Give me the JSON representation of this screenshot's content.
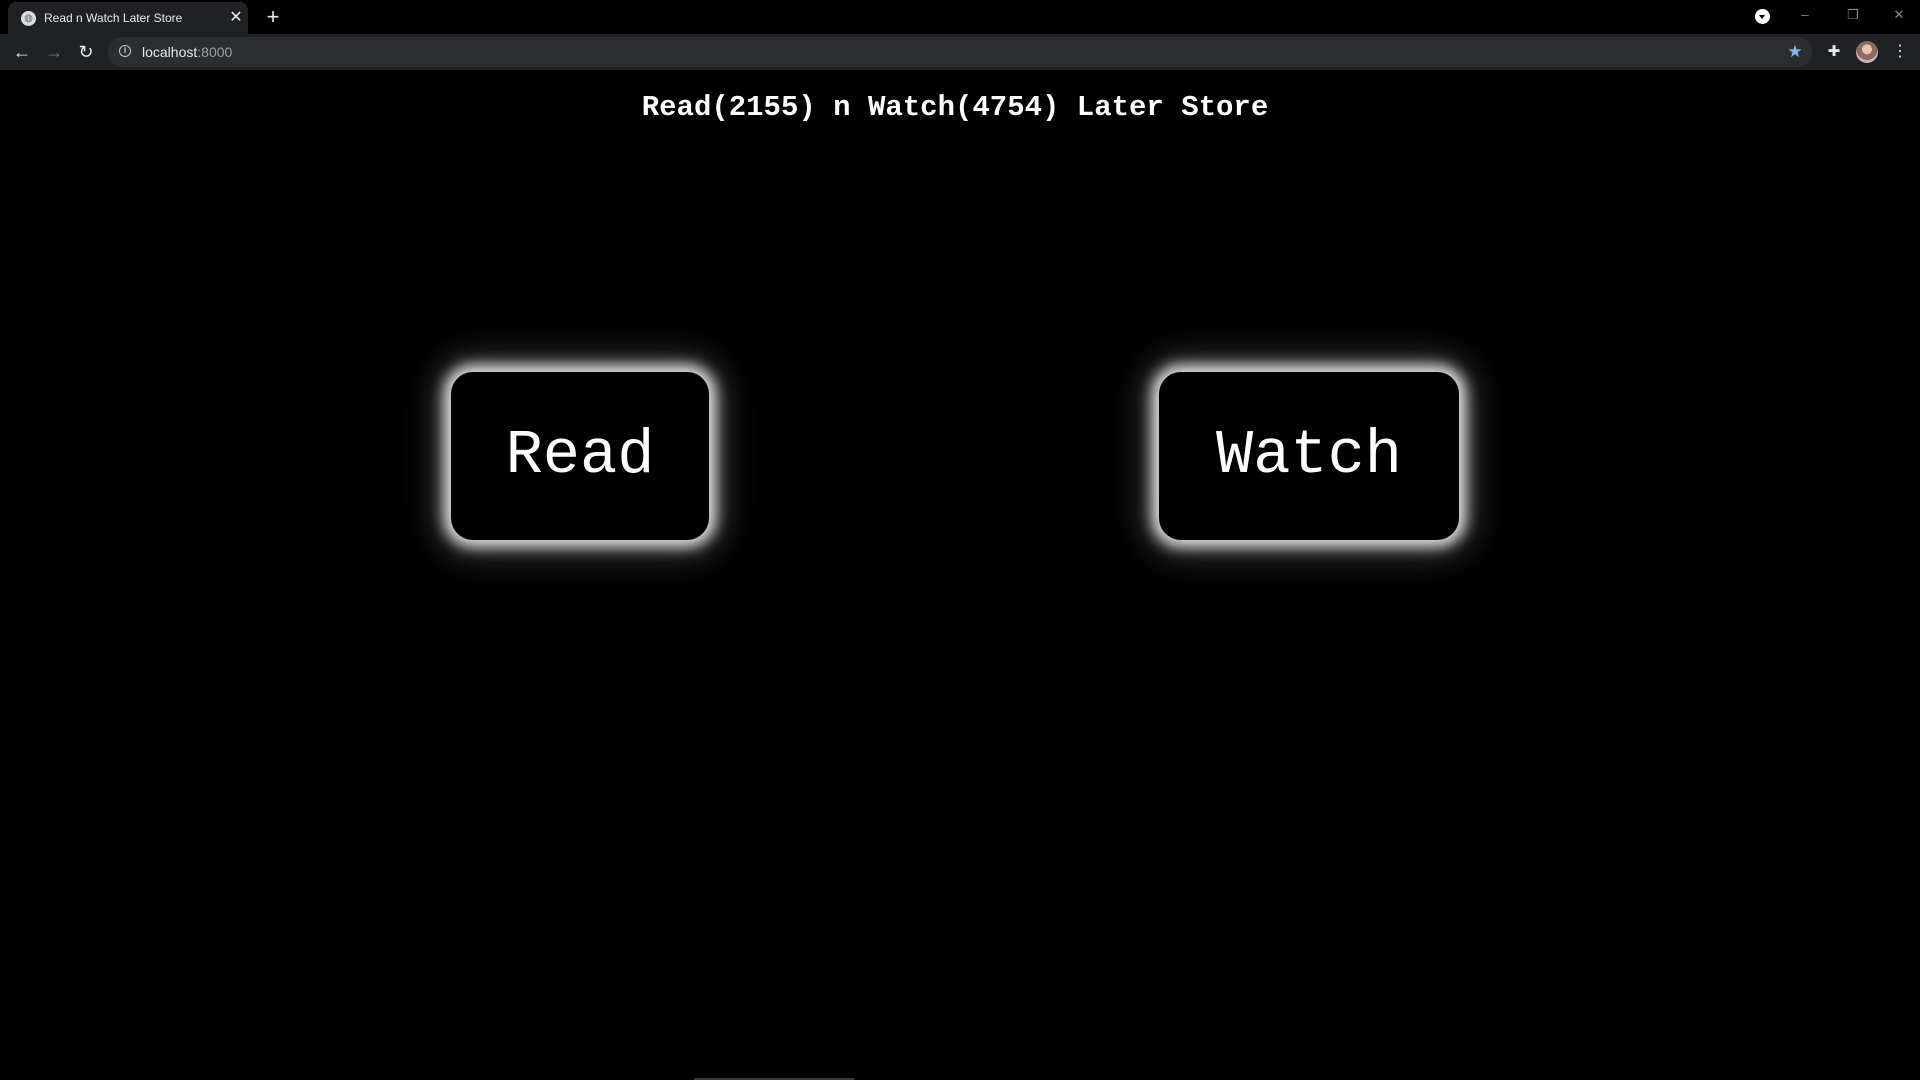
{
  "browser": {
    "tab": {
      "title": "Read n Watch Later Store",
      "favicon": "globe-icon",
      "close_glyph": "✕"
    },
    "new_tab_glyph": "+",
    "window_controls": {
      "minimize": "–",
      "restore": "❐",
      "close": "✕"
    },
    "toolbar": {
      "back_glyph": "←",
      "forward_glyph": "→",
      "reload_glyph": "↻",
      "info_glyph": "i",
      "url_host": "localhost",
      "url_port": ":8000",
      "bookmark_glyph": "★",
      "extensions_glyph": "✚",
      "menu_glyph": "⋮",
      "bookmark_color": "#8ab4f8"
    }
  },
  "page": {
    "title": "Read(2155) n Watch(4754) Later Store",
    "buttons": {
      "read": "Read",
      "watch": "Watch"
    },
    "background_color": "#000000",
    "glow_color": "#ffffff"
  }
}
